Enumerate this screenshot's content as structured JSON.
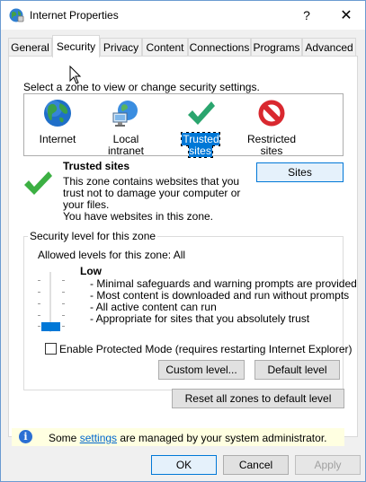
{
  "window": {
    "title": "Internet Properties",
    "help_glyph": "?",
    "close_glyph": "✕"
  },
  "tabs": [
    {
      "label": "General"
    },
    {
      "label": "Security",
      "active": true
    },
    {
      "label": "Privacy"
    },
    {
      "label": "Content"
    },
    {
      "label": "Connections"
    },
    {
      "label": "Programs"
    },
    {
      "label": "Advanced"
    }
  ],
  "zones": {
    "prompt": "Select a zone to view or change security settings.",
    "items": [
      {
        "label": "Internet",
        "icon": "globe-icon"
      },
      {
        "label": "Local intranet",
        "icon": "network-icon"
      },
      {
        "label": "Trusted sites",
        "icon": "checkmark-icon",
        "selected": true
      },
      {
        "label_line1": "Restricted",
        "label_line2": "sites",
        "icon": "restricted-icon"
      }
    ]
  },
  "selected_zone": {
    "title": "Trusted sites",
    "desc_line1": "This zone contains websites that you",
    "desc_line2": "trust not to damage your computer or",
    "desc_line3": "your files.",
    "desc_line4": "You have websites in this zone.",
    "sites_button": "Sites"
  },
  "security_level": {
    "legend": "Security level for this zone",
    "allowed": "Allowed levels for this zone: All",
    "level_name": "Low",
    "bullets": [
      "- Minimal safeguards and warning prompts are provided",
      "- Most content is downloaded and run without prompts",
      "- All active content can run",
      "- Appropriate for sites that you absolutely trust"
    ],
    "slider_level": 0,
    "slider_steps": 5
  },
  "protected_mode": {
    "label": "Enable Protected Mode (requires restarting Internet Explorer)",
    "checked": false
  },
  "buttons": {
    "custom_level": "Custom level...",
    "default_level": "Default level",
    "reset_all": "Reset all zones to default level",
    "ok": "OK",
    "cancel": "Cancel",
    "apply": "Apply"
  },
  "info": {
    "before": "Some ",
    "link": "settings",
    "after": " are managed by your system administrator."
  },
  "colors": {
    "accent": "#0078d7",
    "info_background": "#ffffe1",
    "check_green": "#3cb043",
    "restricted_red": "#d9282f"
  }
}
